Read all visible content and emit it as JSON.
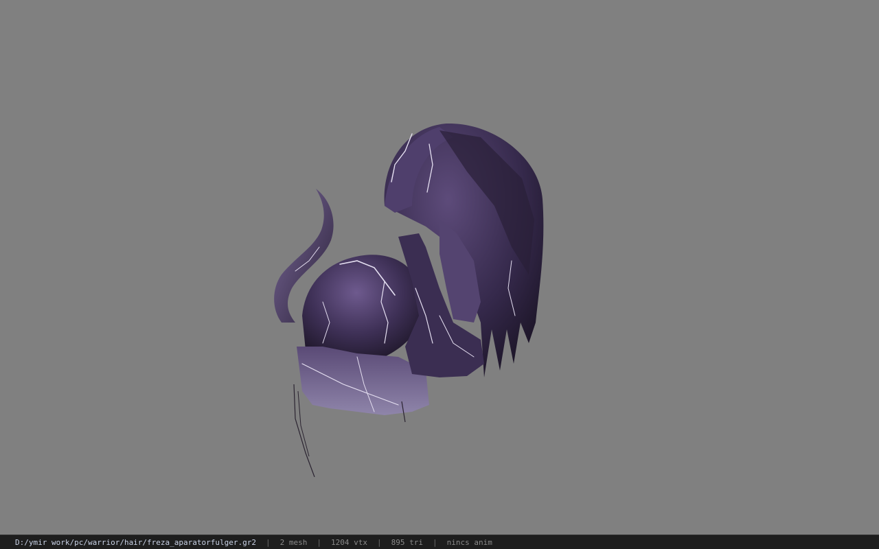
{
  "viewer": {
    "background_color": "#808080",
    "model_colors": {
      "dark": "#1c1526",
      "mid": "#4a3a64",
      "light": "#7d6a9e",
      "lightning": "#e6e0f2"
    }
  },
  "statusbar": {
    "file_path": "D:/ymir work/pc/warrior/hair/freza_aparatorfulger.gr2",
    "separator": "|",
    "mesh_count": "2 mesh",
    "vertex_count": "1204 vtx",
    "triangle_count": "895 tri",
    "anim_status": "nincs anim"
  }
}
